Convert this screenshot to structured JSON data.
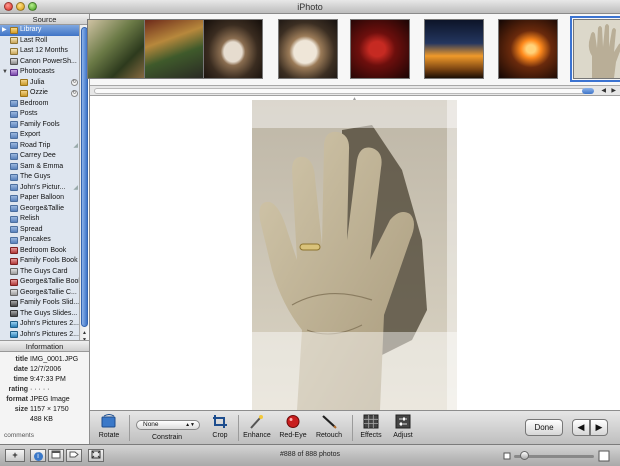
{
  "window": {
    "title": "iPhoto"
  },
  "source": {
    "header": "Source",
    "items": [
      {
        "label": "Library",
        "icon": "library-icon",
        "selected": true,
        "disclosure": "▶"
      },
      {
        "label": "Last Roll",
        "icon": "film-roll-icon"
      },
      {
        "label": "Last 12 Months",
        "icon": "calendar-icon"
      },
      {
        "label": "Canon PowerSh...",
        "icon": "camera-icon"
      },
      {
        "label": "Photocasts",
        "icon": "photocast-icon",
        "disclosure": "▼"
      },
      {
        "label": "Julia",
        "icon": "folder-icon",
        "indent": true,
        "badge": true
      },
      {
        "label": "Ozzie",
        "icon": "folder-icon",
        "indent": true,
        "badge": true
      },
      {
        "label": "Bedroom",
        "icon": "album-icon"
      },
      {
        "label": "Posts",
        "icon": "album-icon"
      },
      {
        "label": "Family Fools",
        "icon": "album-icon"
      },
      {
        "label": "Export",
        "icon": "album-icon"
      },
      {
        "label": "Road Trip",
        "icon": "album-icon",
        "shared": true
      },
      {
        "label": "Carrey Dee",
        "icon": "album-icon"
      },
      {
        "label": "Sam & Emma",
        "icon": "album-icon"
      },
      {
        "label": "The Guys",
        "icon": "album-icon"
      },
      {
        "label": "John's Pictur...",
        "icon": "album-icon",
        "shared": true
      },
      {
        "label": "Paper Balloon",
        "icon": "album-icon"
      },
      {
        "label": "George&Tallie",
        "icon": "album-icon"
      },
      {
        "label": "Relish",
        "icon": "album-icon"
      },
      {
        "label": "Spread",
        "icon": "album-icon"
      },
      {
        "label": "Pancakes",
        "icon": "album-icon"
      },
      {
        "label": "Bedroom Book",
        "icon": "book-icon"
      },
      {
        "label": "Family Fools Book",
        "icon": "book-icon"
      },
      {
        "label": "The Guys Card",
        "icon": "card-icon"
      },
      {
        "label": "George&Tallie Book",
        "icon": "book-icon"
      },
      {
        "label": "George&Tallie C...",
        "icon": "card-icon"
      },
      {
        "label": "Family Fools Slid...",
        "icon": "slideshow-icon"
      },
      {
        "label": "The Guys Slides...",
        "icon": "slideshow-icon"
      },
      {
        "label": "John's Pictures 2...",
        "icon": "shared-album-icon"
      },
      {
        "label": "John's Pictures 2...",
        "icon": "shared-album-icon"
      }
    ]
  },
  "info": {
    "header": "Information",
    "rows": [
      {
        "key": "title",
        "value": "IMG_0001.JPG"
      },
      {
        "key": "date",
        "value": "12/7/2006"
      },
      {
        "key": "time",
        "value": "9:47:33 PM"
      },
      {
        "key": "rating",
        "value": "· · · · ·"
      },
      {
        "key": "format",
        "value": "JPEG Image"
      },
      {
        "key": "size",
        "value": "1157 × 1750"
      },
      {
        "key": "",
        "value": "488 KB"
      }
    ],
    "comments_label": "comments"
  },
  "toolbar": {
    "rotate": "Rotate",
    "constrain_value": "None",
    "constrain": "Constrain",
    "crop": "Crop",
    "enhance": "Enhance",
    "red_eye": "Red-Eye",
    "retouch": "Retouch",
    "effects": "Effects",
    "adjust": "Adjust",
    "done": "Done",
    "prev_arrow": "◀",
    "next_arrow": "▶"
  },
  "status": {
    "photo_count": "#888 of 888 photos",
    "add": "+",
    "info_btn": "i"
  },
  "colors": {
    "selection": "#3f74c6",
    "toolbar_bg": "#d0d0d0",
    "source_bg": "#dfe6ef"
  }
}
